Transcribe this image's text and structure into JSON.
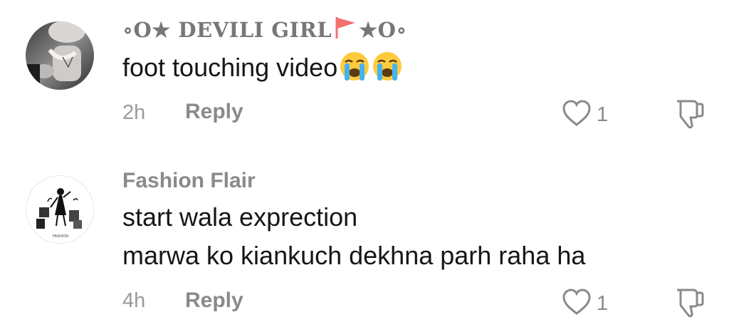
{
  "comments": [
    {
      "username_prefix": "∘O★ DEVILI GIRL",
      "username_suffix": "★O∘",
      "flag_icon": "red-flag-icon",
      "text_lines": [
        "foot touching video"
      ],
      "emoji": "loudly-crying-face-icon",
      "time": "2h",
      "reply_label": "Reply",
      "like_count": "1"
    },
    {
      "username": "Fashion Flair",
      "text_lines": [
        "start wala exprection",
        "marwa ko kiankuch dekhna parh raha ha"
      ],
      "avatar_text": "FASHION",
      "time": "4h",
      "reply_label": "Reply",
      "like_count": "1"
    }
  ],
  "colors": {
    "username": "#8a8a8a",
    "text": "#161616",
    "meta": "#9a9a9a",
    "flag": "#f2706f"
  }
}
